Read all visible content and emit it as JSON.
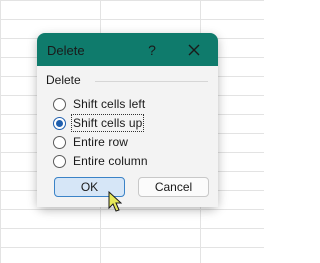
{
  "dialog": {
    "title": "Delete",
    "help_label": "?",
    "group_label": "Delete",
    "options": [
      {
        "label": "Shift cells left",
        "selected": false
      },
      {
        "label": "Shift cells up",
        "selected": true
      },
      {
        "label": "Entire row",
        "selected": false
      },
      {
        "label": "Entire column",
        "selected": false
      }
    ],
    "ok_label": "OK",
    "cancel_label": "Cancel"
  },
  "colors": {
    "titlebar": "#0f7b6c",
    "accent": "#1f5fae"
  },
  "icons": {
    "close": "close-icon",
    "cursor": "mouse-pointer-icon"
  }
}
